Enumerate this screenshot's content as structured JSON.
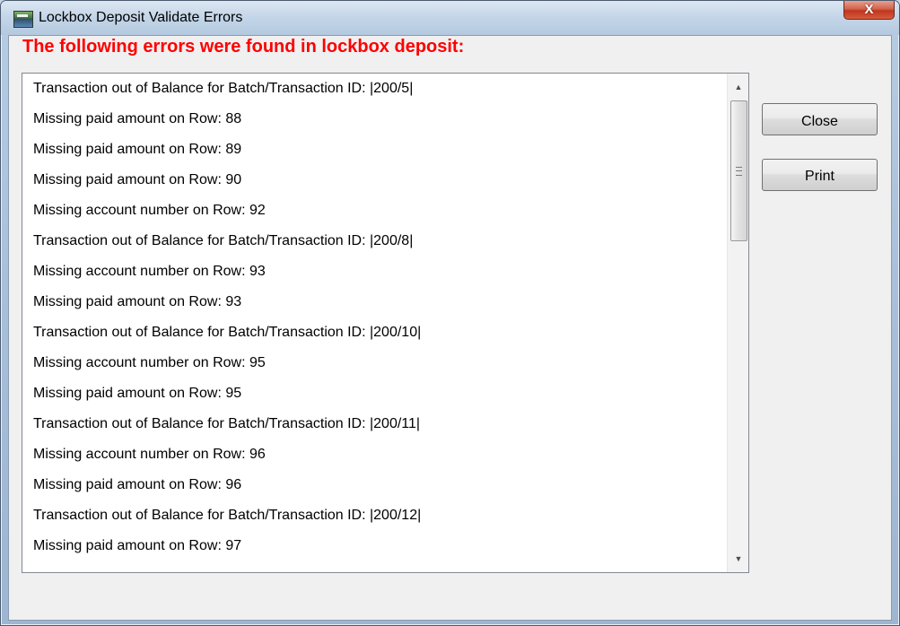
{
  "window": {
    "title": "Lockbox Deposit Validate Errors",
    "close_glyph": "X",
    "icon": "lockbox-app-icon"
  },
  "heading": "The following errors were found in lockbox deposit:",
  "colors": {
    "heading": "#ff0000",
    "title_close_button": "#c0361f"
  },
  "errors": [
    "Transaction out of Balance for Batch/Transaction ID: |200/5|",
    "Missing paid amount on Row: 88",
    "Missing paid amount on Row: 89",
    "Missing paid amount on Row: 90",
    "Missing account number on Row: 92",
    "Transaction out of Balance for Batch/Transaction ID: |200/8|",
    "Missing account number on Row: 93",
    "Missing paid amount on Row: 93",
    "Transaction out of Balance for Batch/Transaction ID: |200/10|",
    "Missing account number on Row: 95",
    "Missing paid amount on Row: 95",
    "Transaction out of Balance for Batch/Transaction ID: |200/11|",
    "Missing account number on Row: 96",
    "Missing paid amount on Row: 96",
    "Transaction out of Balance for Batch/Transaction ID: |200/12|",
    "Missing paid amount on Row: 97"
  ],
  "buttons": {
    "close": "Close",
    "print": "Print"
  },
  "scrollbar": {
    "up_glyph": "▲",
    "down_glyph": "▼"
  }
}
